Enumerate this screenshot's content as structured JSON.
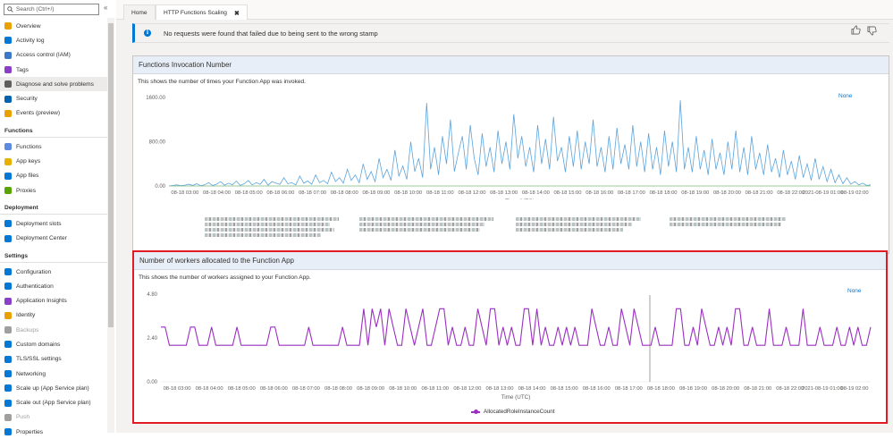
{
  "sidebar": {
    "search_placeholder": "Search (Ctrl+/)",
    "collapse": "«",
    "top_items": [
      {
        "label": "Overview",
        "icon": "lightning-icon",
        "color": "#e8a100"
      },
      {
        "label": "Activity log",
        "icon": "log-icon",
        "color": "#0078d4"
      },
      {
        "label": "Access control (IAM)",
        "icon": "users-icon",
        "color": "#3c78c8"
      },
      {
        "label": "Tags",
        "icon": "tag-icon",
        "color": "#8a3fc9"
      },
      {
        "label": "Diagnose and solve problems",
        "icon": "wrench-icon",
        "color": "#605e5c"
      },
      {
        "label": "Security",
        "icon": "shield-icon",
        "color": "#0063b1"
      },
      {
        "label": "Events (preview)",
        "icon": "bolt-icon",
        "color": "#e8a100"
      }
    ],
    "functions_header": "Functions",
    "functions_items": [
      {
        "label": "Functions",
        "icon": "functions-icon",
        "color": "#5e8ae0"
      },
      {
        "label": "App keys",
        "icon": "key-icon",
        "color": "#e8b100"
      },
      {
        "label": "App files",
        "icon": "files-icon",
        "color": "#0078d4"
      },
      {
        "label": "Proxies",
        "icon": "proxies-icon",
        "color": "#57a300"
      }
    ],
    "deployment_header": "Deployment",
    "deployment_items": [
      {
        "label": "Deployment slots",
        "icon": "slots-icon",
        "color": "#0078d4"
      },
      {
        "label": "Deployment Center",
        "icon": "cube-icon",
        "color": "#0078d4"
      }
    ],
    "settings_header": "Settings",
    "settings_items": [
      {
        "label": "Configuration",
        "icon": "config-icon",
        "color": "#0078d4"
      },
      {
        "label": "Authentication",
        "icon": "auth-icon",
        "color": "#0078d4"
      },
      {
        "label": "Application Insights",
        "icon": "insights-icon",
        "color": "#8a3fc9"
      },
      {
        "label": "Identity",
        "icon": "identity-icon",
        "color": "#e8a100"
      },
      {
        "label": "Backups",
        "icon": "backups-icon",
        "color": "#a19f9d"
      },
      {
        "label": "Custom domains",
        "icon": "domains-icon",
        "color": "#0078d4"
      },
      {
        "label": "TLS/SSL settings",
        "icon": "tls-icon",
        "color": "#0078d4"
      },
      {
        "label": "Networking",
        "icon": "networking-icon",
        "color": "#0078d4"
      },
      {
        "label": "Scale up (App Service plan)",
        "icon": "scaleup-icon",
        "color": "#0078d4"
      },
      {
        "label": "Scale out (App Service plan)",
        "icon": "scaleout-icon",
        "color": "#0078d4"
      },
      {
        "label": "Push",
        "icon": "push-icon",
        "color": "#a19f9d"
      },
      {
        "label": "Properties",
        "icon": "properties-icon",
        "color": "#0078d4"
      }
    ]
  },
  "tabs": [
    {
      "label": "Home"
    },
    {
      "label": "HTTP Functions Scaling",
      "close": "✖"
    }
  ],
  "banner": {
    "info": "i",
    "message": "No requests were found that failed due to being sent to the wrong stamp",
    "like_icon": "thumbs-up-icon",
    "dislike_icon": "thumbs-down-icon"
  },
  "card1": {
    "title": "Functions Invocation Number",
    "description": "This shows the number of times your Function App was invoked.",
    "none_label": "None"
  },
  "card2": {
    "title": "Number of workers allocated to the Function App",
    "description": "This shows the number of workers assigned to your Function App.",
    "none_label": "None",
    "legend": "AllocatedRoleInstanceCount"
  },
  "chart_data": [
    {
      "type": "line",
      "title": "Functions Invocation Number",
      "xlabel": "Time (UTC)",
      "ylabel": "",
      "ylim": [
        0,
        1600
      ],
      "yticks": [
        "1600.00",
        "800.00",
        "0.00"
      ],
      "x_tick_labels": [
        "08-18 03:00",
        "08-18 04:00",
        "08-18 05:00",
        "08-18 06:00",
        "08-18 07:00",
        "08-18 08:00",
        "08-18 09:00",
        "08-18 10:00",
        "08-18 11:00",
        "08-18 12:00",
        "08-18 13:00",
        "08-18 14:00",
        "08-18 15:00",
        "08-18 16:00",
        "08-18 17:00",
        "08-18 18:00",
        "08-18 19:00",
        "08-18 20:00",
        "08-18 21:00",
        "08-18 22:00",
        "2021-08-19 01:00",
        "08-19 02:00"
      ],
      "series": [
        {
          "color": "#5ba3dc",
          "values": [
            0,
            10,
            20,
            5,
            15,
            30,
            10,
            40,
            5,
            20,
            60,
            10,
            30,
            80,
            15,
            50,
            20,
            90,
            10,
            40,
            100,
            20,
            60,
            30,
            120,
            15,
            80,
            50,
            30,
            150,
            40,
            60,
            20,
            180,
            50,
            90,
            30,
            200,
            60,
            100,
            40,
            250,
            80,
            150,
            50,
            300,
            100,
            200,
            60,
            400,
            120,
            260,
            80,
            500,
            150,
            300,
            100,
            650,
            180,
            360,
            120,
            800,
            260,
            500,
            150,
            1500,
            300,
            700,
            200,
            900,
            400,
            1200,
            260,
            600,
            900,
            300,
            1100,
            500,
            200,
            950,
            350,
            700,
            250,
            1000,
            400,
            800,
            300,
            1300,
            500,
            900,
            350,
            700,
            250,
            1100,
            400,
            850,
            300,
            1250,
            450,
            700,
            250,
            900,
            350,
            1000,
            300,
            800,
            400,
            1200,
            350,
            700,
            250,
            900,
            300,
            1050,
            400,
            750,
            300,
            1100,
            350,
            800,
            250,
            950,
            300,
            700,
            200,
            1000,
            350,
            800,
            250,
            1550,
            300,
            700,
            250,
            900,
            300,
            650,
            200,
            850,
            300,
            600,
            200,
            800,
            300,
            1000,
            250,
            700,
            200,
            900,
            300,
            600,
            200,
            750,
            250,
            500,
            150,
            650,
            200,
            450,
            120,
            550,
            150,
            400,
            100,
            500,
            120,
            350,
            80,
            300,
            60,
            200,
            40,
            150,
            30,
            80,
            20,
            50,
            10,
            20
          ]
        },
        {
          "color": "#7cbf7c",
          "values": [
            0,
            0,
            0,
            0,
            0,
            0,
            0,
            0,
            0,
            0,
            0,
            0,
            0,
            0,
            0,
            0,
            0,
            0,
            0,
            0,
            0,
            0,
            0,
            0,
            0,
            0,
            0,
            0,
            0,
            0,
            0,
            0,
            0,
            0,
            0,
            0,
            0,
            0,
            0,
            0,
            0,
            0,
            0,
            0,
            0,
            0,
            0,
            0,
            0,
            0,
            0,
            0,
            0,
            0,
            0,
            0,
            0,
            0,
            0,
            0,
            0,
            0,
            0,
            0,
            0,
            0,
            0,
            0,
            0,
            0,
            0,
            0,
            0,
            0,
            0,
            0,
            0,
            0,
            0,
            0,
            0,
            0,
            0,
            0,
            0,
            0,
            0,
            0,
            0,
            0,
            0,
            0,
            0,
            0,
            0,
            0,
            0,
            0,
            0,
            0,
            0,
            0,
            0,
            0,
            0,
            0,
            0,
            0,
            0,
            0,
            0,
            0,
            0,
            0,
            0,
            0,
            0,
            0,
            0,
            0,
            0,
            0,
            0,
            0,
            0,
            0,
            0,
            0,
            0,
            0,
            0,
            0,
            0,
            0,
            0,
            0,
            0,
            0,
            0,
            0,
            0,
            0,
            0,
            0,
            0,
            0,
            0,
            0,
            0,
            0,
            0,
            0,
            0,
            0,
            0,
            0,
            0,
            0,
            0,
            0,
            0,
            0,
            0,
            0,
            0,
            0,
            0,
            0,
            0,
            0,
            0
          ]
        }
      ]
    },
    {
      "type": "line",
      "title": "Number of workers allocated to the Function App",
      "xlabel": "Time (UTC)",
      "ylabel": "",
      "ylim": [
        0,
        4.8
      ],
      "yticks": [
        "4.80",
        "2.40",
        "0.00"
      ],
      "x_tick_labels": [
        "08-18 03:00",
        "08-18 04:00",
        "08-18 05:00",
        "08-18 06:00",
        "08-18 07:00",
        "08-18 08:00",
        "08-18 09:00",
        "08-18 10:00",
        "08-18 11:00",
        "08-18 12:00",
        "08-18 13:00",
        "08-18 14:00",
        "08-18 15:00",
        "08-18 16:00",
        "08-18 17:00",
        "08-18 18:00",
        "08-18 19:00",
        "08-18 20:00",
        "08-18 21:00",
        "08-18 22:00",
        "2021-08-19 01:00",
        "08-19 02:00"
      ],
      "series": [
        {
          "name": "AllocatedRoleInstanceCount",
          "color": "#9b2fc1",
          "values": [
            3,
            3,
            2,
            2,
            2,
            2,
            2,
            3,
            3,
            2,
            2,
            2,
            3,
            2,
            2,
            2,
            2,
            2,
            3,
            2,
            2,
            2,
            2,
            2,
            2,
            2,
            3,
            3,
            2,
            2,
            2,
            2,
            2,
            2,
            2,
            3,
            2,
            2,
            2,
            2,
            2,
            2,
            2,
            3,
            2,
            2,
            2,
            2,
            4,
            2,
            4,
            3,
            4,
            2,
            4,
            3,
            2,
            2,
            4,
            3,
            2,
            3,
            4,
            2,
            2,
            3,
            4,
            4,
            2,
            3,
            2,
            2,
            3,
            2,
            2,
            4,
            3,
            2,
            4,
            4,
            2,
            3,
            2,
            3,
            2,
            2,
            4,
            4,
            2,
            4,
            2,
            3,
            2,
            2,
            3,
            2,
            3,
            2,
            3,
            2,
            2,
            2,
            4,
            3,
            2,
            2,
            3,
            2,
            2,
            4,
            3,
            2,
            4,
            3,
            2,
            2,
            2,
            3,
            2,
            2,
            2,
            2,
            4,
            4,
            2,
            2,
            3,
            2,
            4,
            3,
            2,
            2,
            3,
            2,
            3,
            2,
            4,
            4,
            2,
            2,
            3,
            2,
            2,
            2,
            4,
            2,
            2,
            2,
            3,
            2,
            2,
            2,
            4,
            2,
            2,
            2,
            3,
            2,
            2,
            2,
            3,
            2,
            2,
            3,
            2,
            3,
            2,
            2,
            3
          ]
        }
      ]
    }
  ]
}
